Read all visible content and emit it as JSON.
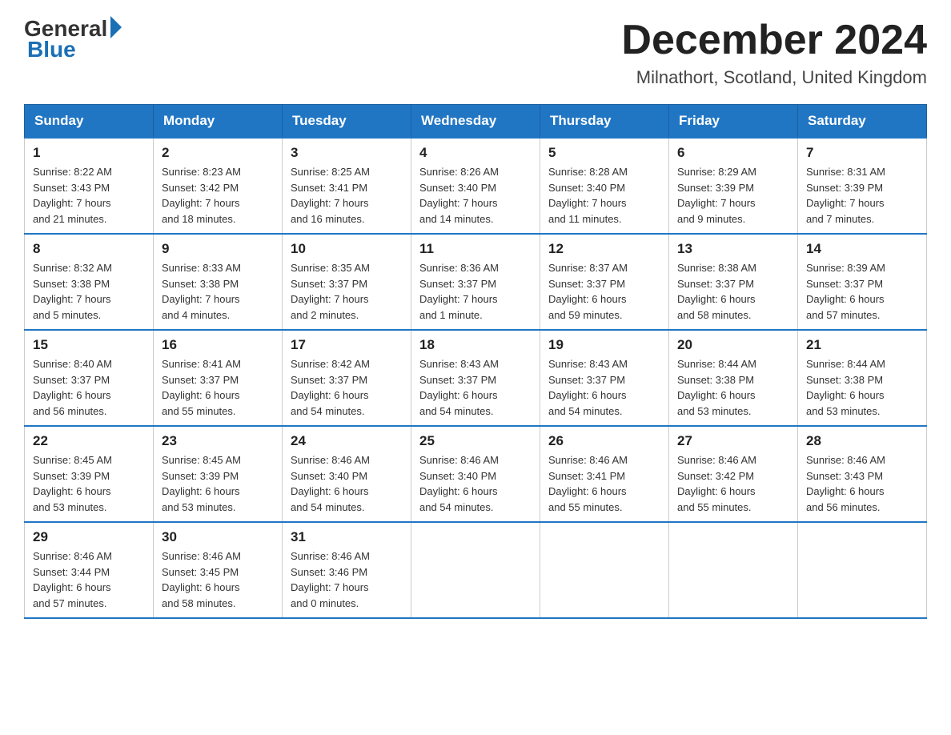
{
  "header": {
    "logo_general": "General",
    "logo_blue": "Blue",
    "month_title": "December 2024",
    "location": "Milnathort, Scotland, United Kingdom"
  },
  "days_of_week": [
    "Sunday",
    "Monday",
    "Tuesday",
    "Wednesday",
    "Thursday",
    "Friday",
    "Saturday"
  ],
  "weeks": [
    [
      {
        "day": "1",
        "sunrise": "8:22 AM",
        "sunset": "3:43 PM",
        "daylight": "7 hours and 21 minutes."
      },
      {
        "day": "2",
        "sunrise": "8:23 AM",
        "sunset": "3:42 PM",
        "daylight": "7 hours and 18 minutes."
      },
      {
        "day": "3",
        "sunrise": "8:25 AM",
        "sunset": "3:41 PM",
        "daylight": "7 hours and 16 minutes."
      },
      {
        "day": "4",
        "sunrise": "8:26 AM",
        "sunset": "3:40 PM",
        "daylight": "7 hours and 14 minutes."
      },
      {
        "day": "5",
        "sunrise": "8:28 AM",
        "sunset": "3:40 PM",
        "daylight": "7 hours and 11 minutes."
      },
      {
        "day": "6",
        "sunrise": "8:29 AM",
        "sunset": "3:39 PM",
        "daylight": "7 hours and 9 minutes."
      },
      {
        "day": "7",
        "sunrise": "8:31 AM",
        "sunset": "3:39 PM",
        "daylight": "7 hours and 7 minutes."
      }
    ],
    [
      {
        "day": "8",
        "sunrise": "8:32 AM",
        "sunset": "3:38 PM",
        "daylight": "7 hours and 5 minutes."
      },
      {
        "day": "9",
        "sunrise": "8:33 AM",
        "sunset": "3:38 PM",
        "daylight": "7 hours and 4 minutes."
      },
      {
        "day": "10",
        "sunrise": "8:35 AM",
        "sunset": "3:37 PM",
        "daylight": "7 hours and 2 minutes."
      },
      {
        "day": "11",
        "sunrise": "8:36 AM",
        "sunset": "3:37 PM",
        "daylight": "7 hours and 1 minute."
      },
      {
        "day": "12",
        "sunrise": "8:37 AM",
        "sunset": "3:37 PM",
        "daylight": "6 hours and 59 minutes."
      },
      {
        "day": "13",
        "sunrise": "8:38 AM",
        "sunset": "3:37 PM",
        "daylight": "6 hours and 58 minutes."
      },
      {
        "day": "14",
        "sunrise": "8:39 AM",
        "sunset": "3:37 PM",
        "daylight": "6 hours and 57 minutes."
      }
    ],
    [
      {
        "day": "15",
        "sunrise": "8:40 AM",
        "sunset": "3:37 PM",
        "daylight": "6 hours and 56 minutes."
      },
      {
        "day": "16",
        "sunrise": "8:41 AM",
        "sunset": "3:37 PM",
        "daylight": "6 hours and 55 minutes."
      },
      {
        "day": "17",
        "sunrise": "8:42 AM",
        "sunset": "3:37 PM",
        "daylight": "6 hours and 54 minutes."
      },
      {
        "day": "18",
        "sunrise": "8:43 AM",
        "sunset": "3:37 PM",
        "daylight": "6 hours and 54 minutes."
      },
      {
        "day": "19",
        "sunrise": "8:43 AM",
        "sunset": "3:37 PM",
        "daylight": "6 hours and 54 minutes."
      },
      {
        "day": "20",
        "sunrise": "8:44 AM",
        "sunset": "3:38 PM",
        "daylight": "6 hours and 53 minutes."
      },
      {
        "day": "21",
        "sunrise": "8:44 AM",
        "sunset": "3:38 PM",
        "daylight": "6 hours and 53 minutes."
      }
    ],
    [
      {
        "day": "22",
        "sunrise": "8:45 AM",
        "sunset": "3:39 PM",
        "daylight": "6 hours and 53 minutes."
      },
      {
        "day": "23",
        "sunrise": "8:45 AM",
        "sunset": "3:39 PM",
        "daylight": "6 hours and 53 minutes."
      },
      {
        "day": "24",
        "sunrise": "8:46 AM",
        "sunset": "3:40 PM",
        "daylight": "6 hours and 54 minutes."
      },
      {
        "day": "25",
        "sunrise": "8:46 AM",
        "sunset": "3:40 PM",
        "daylight": "6 hours and 54 minutes."
      },
      {
        "day": "26",
        "sunrise": "8:46 AM",
        "sunset": "3:41 PM",
        "daylight": "6 hours and 55 minutes."
      },
      {
        "day": "27",
        "sunrise": "8:46 AM",
        "sunset": "3:42 PM",
        "daylight": "6 hours and 55 minutes."
      },
      {
        "day": "28",
        "sunrise": "8:46 AM",
        "sunset": "3:43 PM",
        "daylight": "6 hours and 56 minutes."
      }
    ],
    [
      {
        "day": "29",
        "sunrise": "8:46 AM",
        "sunset": "3:44 PM",
        "daylight": "6 hours and 57 minutes."
      },
      {
        "day": "30",
        "sunrise": "8:46 AM",
        "sunset": "3:45 PM",
        "daylight": "6 hours and 58 minutes."
      },
      {
        "day": "31",
        "sunrise": "8:46 AM",
        "sunset": "3:46 PM",
        "daylight": "7 hours and 0 minutes."
      },
      null,
      null,
      null,
      null
    ]
  ],
  "labels": {
    "sunrise": "Sunrise:",
    "sunset": "Sunset:",
    "daylight": "Daylight:"
  }
}
